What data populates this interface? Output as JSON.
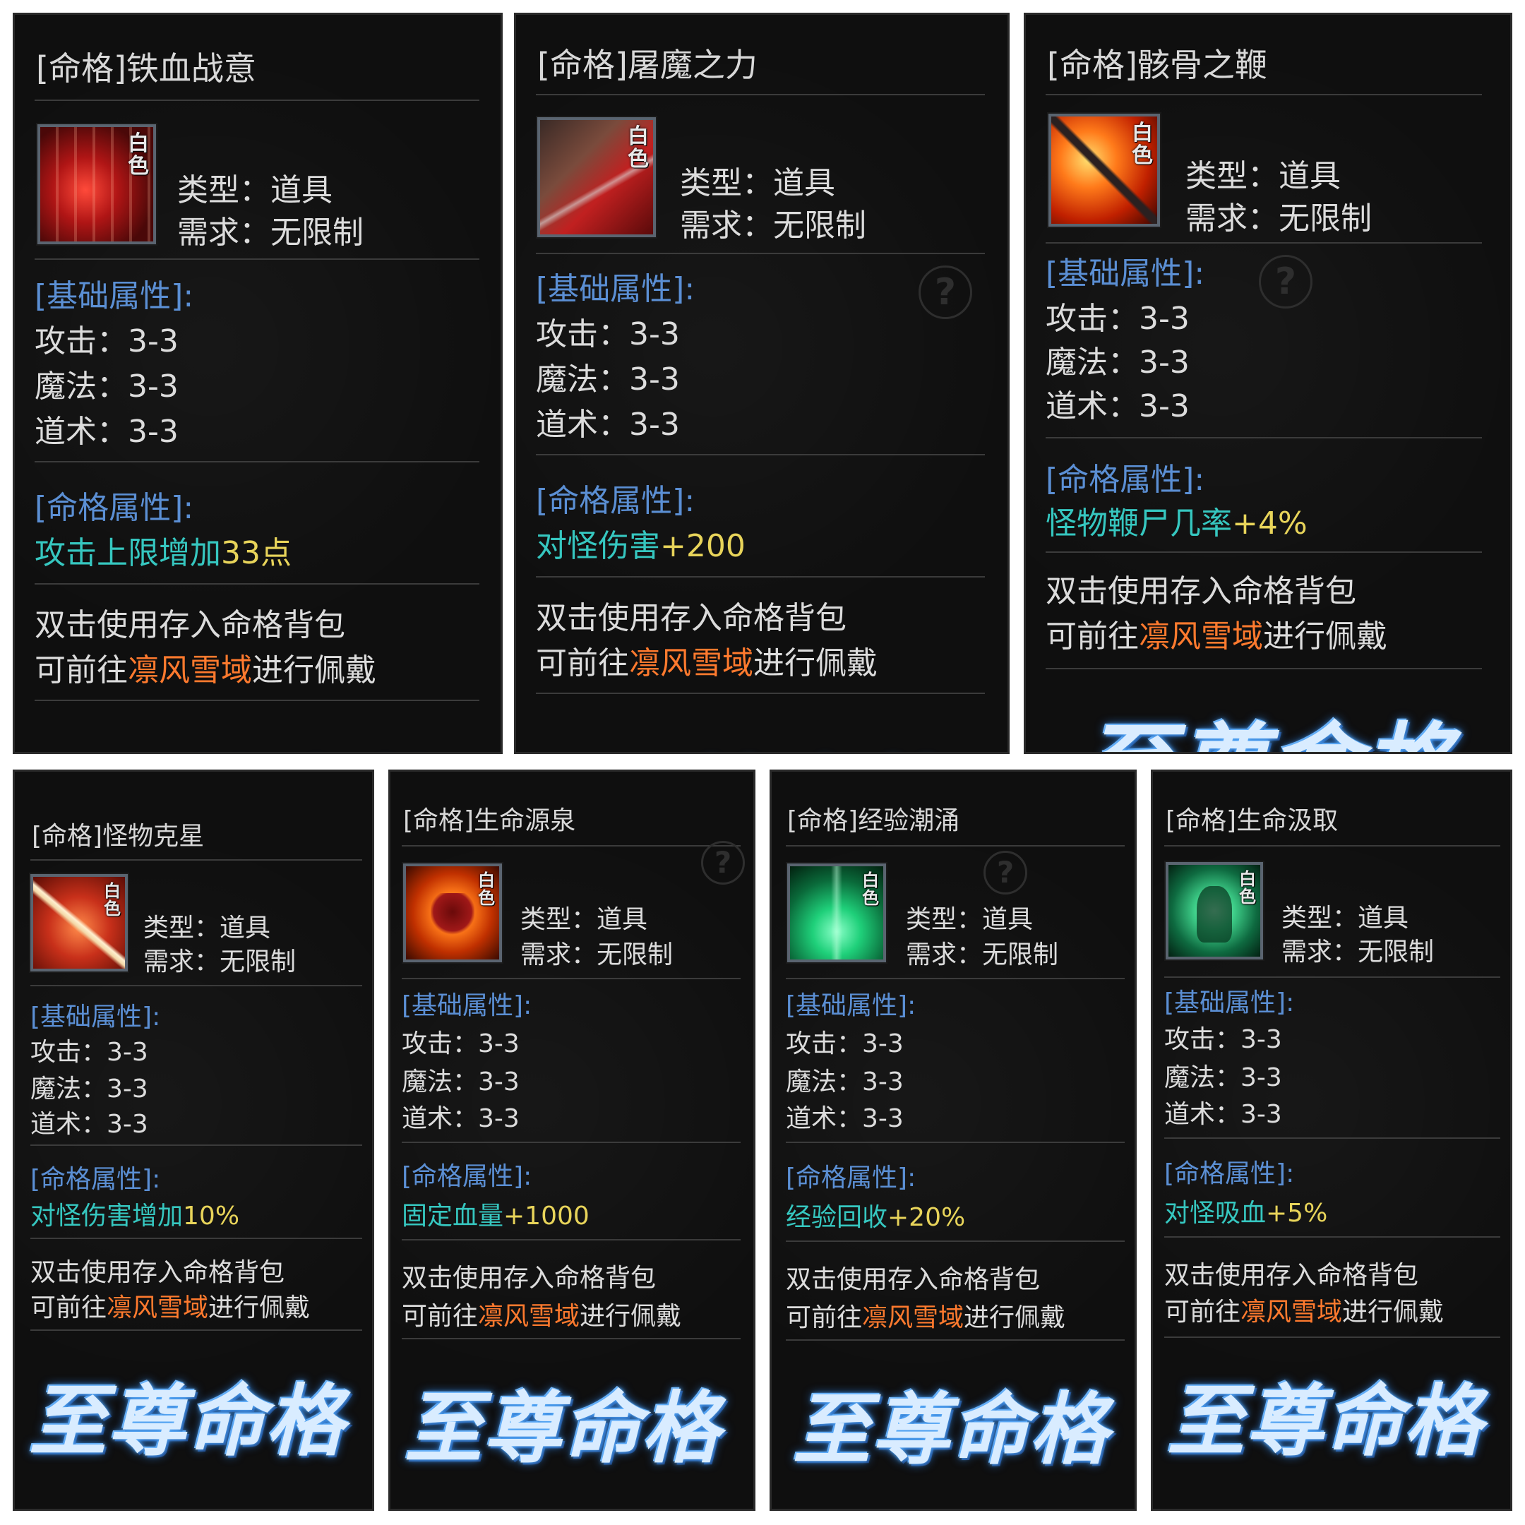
{
  "common": {
    "quality_label": "白色",
    "type_label": "类型：",
    "type_value": "道具",
    "req_label": "需求：",
    "req_value": "无限制",
    "base_section": "[基础属性]:",
    "attack": "攻击：3-3",
    "magic": "魔法：3-3",
    "taoism": "道术：3-3",
    "fate_section": "[命格属性]:",
    "note_line1": "双击使用存入命格背包",
    "note_line2_pre": "可前往",
    "note_location": "凛风雪域",
    "note_line2_post": "进行佩戴",
    "banner": "至尊命格"
  },
  "items": [
    {
      "name": "[命格]铁血战意",
      "attr_text": "攻击上限增加",
      "attr_value": "33点",
      "icon": "red-warrior-icon"
    },
    {
      "name": "[命格]屠魔之力",
      "attr_text": "对怪伤害",
      "attr_value": "+200",
      "icon": "blade-warrior-icon"
    },
    {
      "name": "[命格]骸骨之鞭",
      "attr_text": "怪物鞭尸几率",
      "attr_value": "+4%",
      "icon": "flaming-spear-icon"
    },
    {
      "name": "[命格]怪物克星",
      "attr_text": "对怪伤害增加",
      "attr_value": "10%",
      "icon": "sword-slash-icon"
    },
    {
      "name": "[命格]生命源泉",
      "attr_text": "固定血量",
      "attr_value": "+1000",
      "icon": "burning-heart-icon"
    },
    {
      "name": "[命格]经验潮涌",
      "attr_text": "经验回收",
      "attr_value": "+20%",
      "icon": "green-fountain-icon"
    },
    {
      "name": "[命格]生命汲取",
      "attr_text": "对怪吸血",
      "attr_value": "+5%",
      "icon": "green-spirit-icon"
    }
  ],
  "colors": {
    "section_blue": "#5b8fd4",
    "attr_cyan": "#36c7c0",
    "attr_yellow": "#e8d45a",
    "location_orange": "#ff7a2e",
    "card_bg": "#0f0f0f"
  }
}
